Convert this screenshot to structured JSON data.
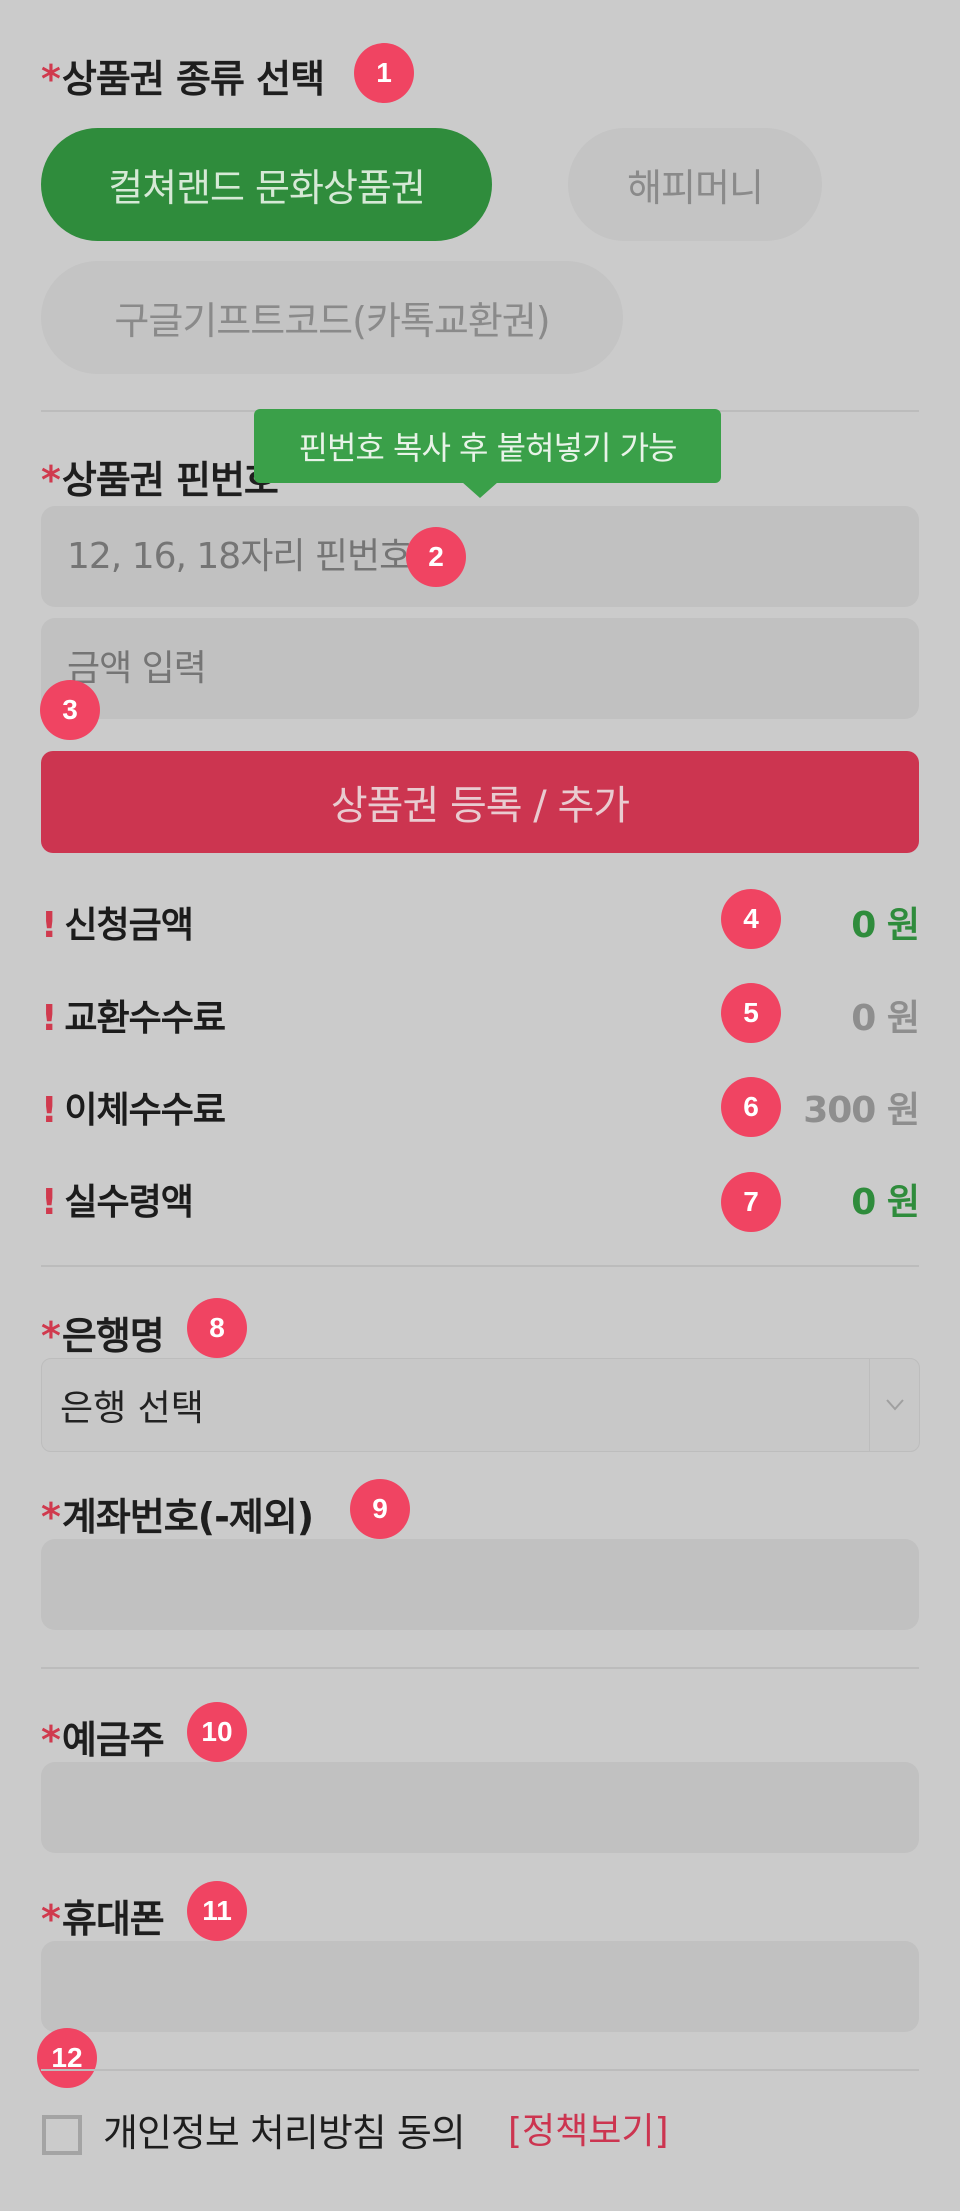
{
  "voucher_type": {
    "label": "상품권 종류 선택",
    "options": [
      {
        "label": "컬쳐랜드 문화상품권",
        "active": true
      },
      {
        "label": "해피머니",
        "active": false
      },
      {
        "label": "구글기프트코드(카톡교환권)",
        "active": false
      }
    ]
  },
  "pin": {
    "label": "상품권 핀번호",
    "tooltip": "핀번호 복사 후 붙혀넣기 가능",
    "pin_placeholder": "12, 16, 18자리 핀번호",
    "amount_placeholder": "금액 입력"
  },
  "submit_label": "상품권 등록 / 추가",
  "summary": [
    {
      "label": "신청금액",
      "value": "0 원",
      "color": "#2f8c3c"
    },
    {
      "label": "교환수수료",
      "value": "0 원",
      "color": "#8e8e8e"
    },
    {
      "label": "이체수수료",
      "value": "300 원",
      "color": "#8e8e8e"
    },
    {
      "label": "실수령액",
      "value": "0 원",
      "color": "#2f8c3c"
    }
  ],
  "bank": {
    "label": "은행명",
    "selected": "은행 선택"
  },
  "account": {
    "label": "계좌번호(-제외)"
  },
  "holder": {
    "label": "예금주"
  },
  "phone": {
    "label": "휴대폰"
  },
  "agreement": {
    "label": "개인정보 처리방침 동의",
    "policy_link": "[정책보기]"
  },
  "required_mark": "*",
  "notice_mark": "!",
  "badges": [
    "1",
    "2",
    "3",
    "4",
    "5",
    "6",
    "7",
    "8",
    "9",
    "10",
    "11",
    "12"
  ],
  "colors": {
    "accent_green": "#2f8c3c",
    "accent_red": "#cc3550",
    "badge": "#f04462"
  }
}
